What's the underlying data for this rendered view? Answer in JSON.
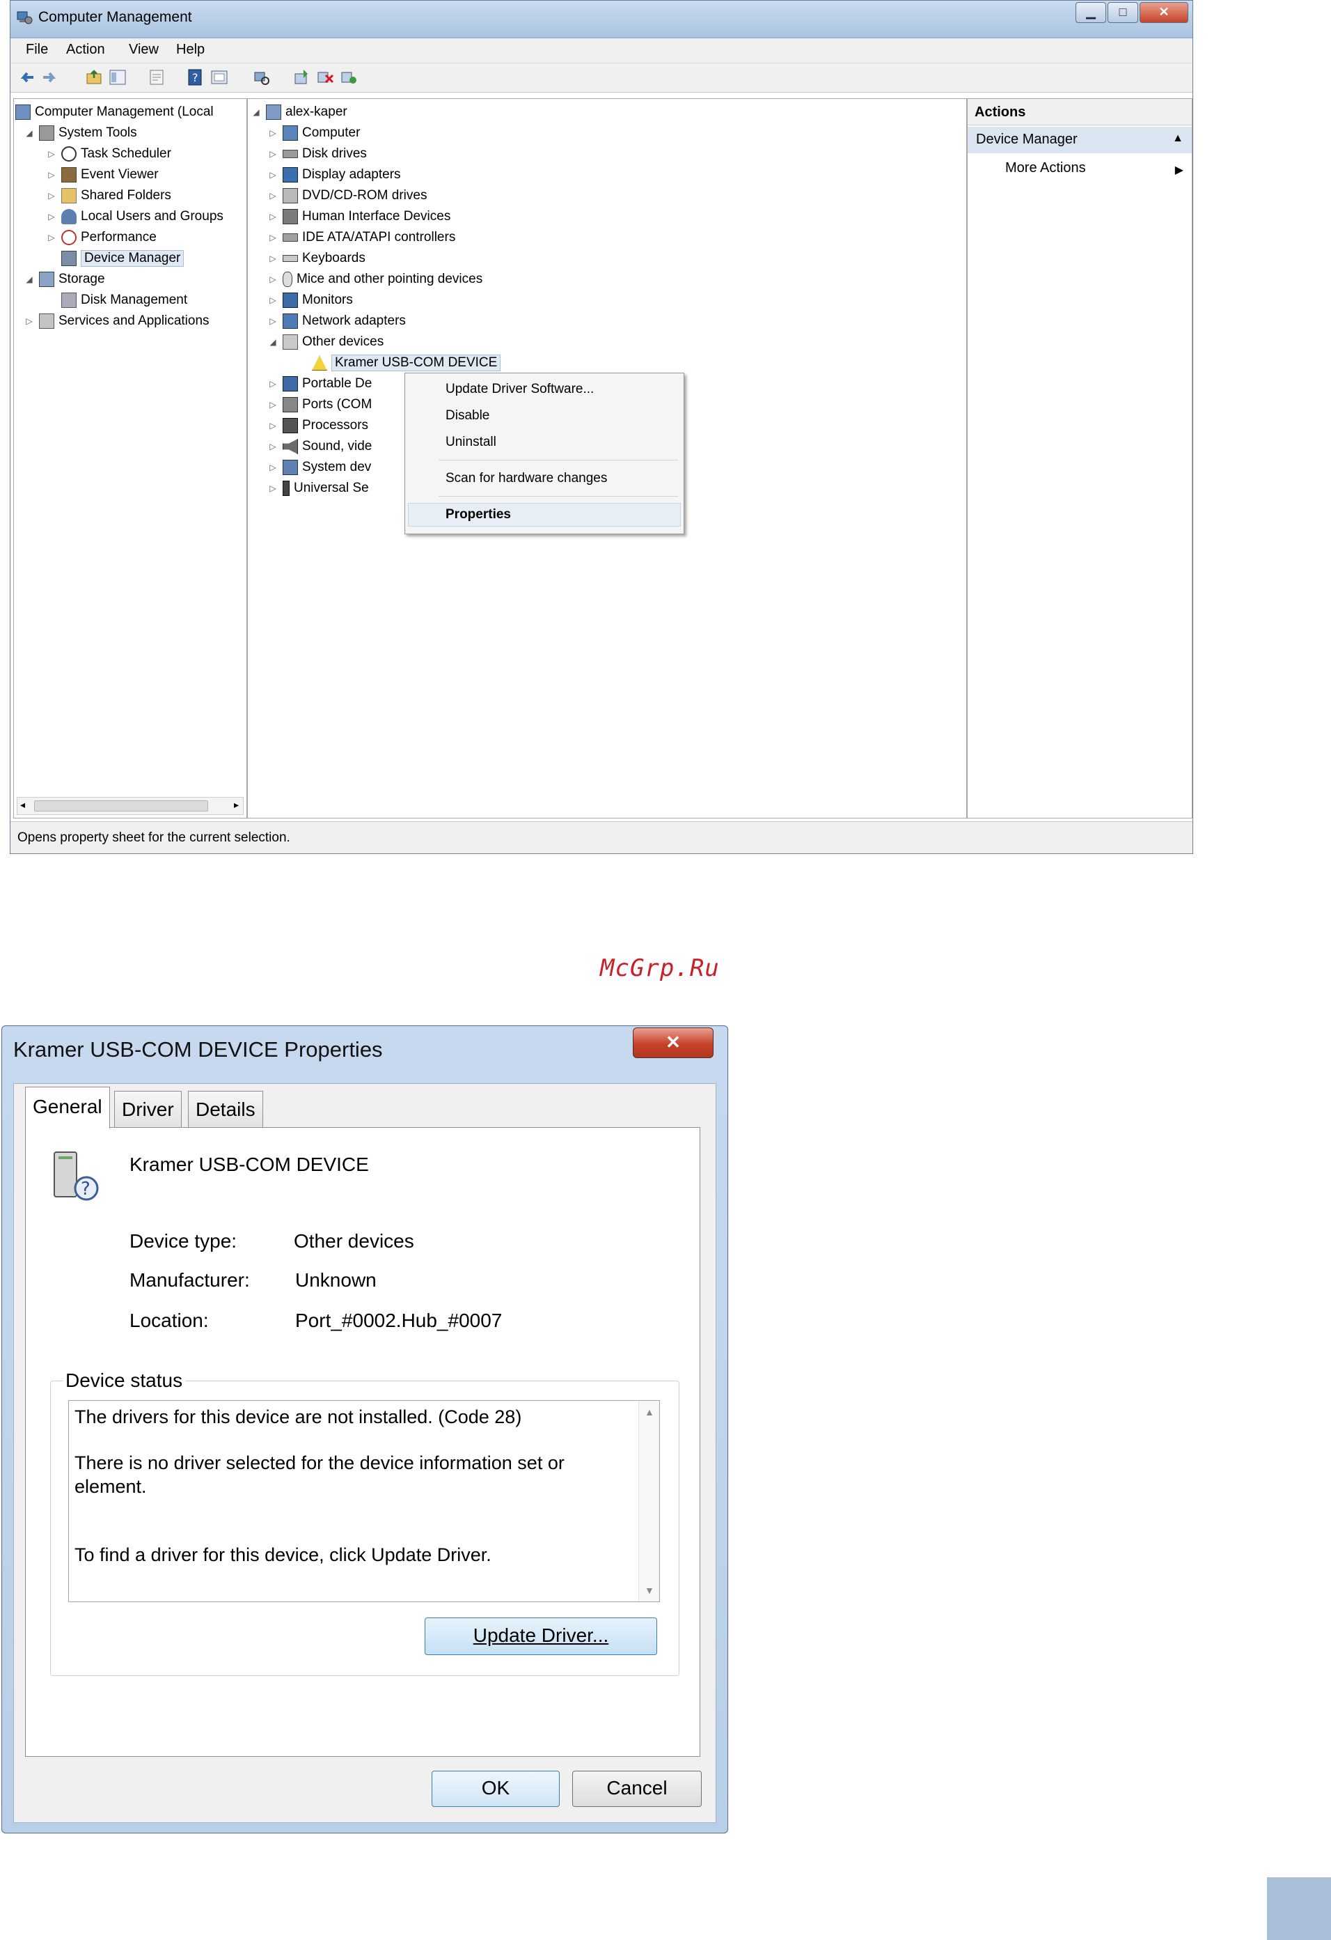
{
  "cm": {
    "title": "Computer Management",
    "menu": [
      "File",
      "Action",
      "View",
      "Help"
    ],
    "left_tree": [
      {
        "label": "Computer Management (Local",
        "indent": 0
      },
      {
        "label": "System Tools",
        "indent": 1
      },
      {
        "label": "Task Scheduler",
        "indent": 2
      },
      {
        "label": "Event Viewer",
        "indent": 2
      },
      {
        "label": "Shared Folders",
        "indent": 2
      },
      {
        "label": "Local Users and Groups",
        "indent": 2
      },
      {
        "label": "Performance",
        "indent": 2
      },
      {
        "label": "Device Manager",
        "indent": 2
      },
      {
        "label": "Storage",
        "indent": 1
      },
      {
        "label": "Disk Management",
        "indent": 2
      },
      {
        "label": "Services and Applications",
        "indent": 1
      }
    ],
    "device_tree": [
      "alex-kaper",
      "Computer",
      "Disk drives",
      "Display adapters",
      "DVD/CD-ROM drives",
      "Human Interface Devices",
      "IDE ATA/ATAPI controllers",
      "Keyboards",
      "Mice and other pointing devices",
      "Monitors",
      "Network adapters",
      "Other devices",
      "Kramer USB-COM DEVICE",
      "Portable De",
      "Ports (COM",
      "Processors",
      "Sound, vide",
      "System dev",
      "Universal Se"
    ],
    "context_menu": [
      "Update Driver Software...",
      "Disable",
      "Uninstall",
      "Scan for hardware changes",
      "Properties"
    ],
    "actions": {
      "header": "Actions",
      "section": "Device Manager",
      "more": "More Actions"
    },
    "status": "Opens property sheet for the current selection."
  },
  "watermark": "McGrp.Ru",
  "dialog": {
    "title": "Kramer USB-COM DEVICE Properties",
    "close": "✕",
    "tabs": [
      "General",
      "Driver",
      "Details"
    ],
    "device_name": "Kramer USB-COM DEVICE",
    "fields": [
      {
        "label": "Device type:",
        "value": "Other devices"
      },
      {
        "label": "Manufacturer:",
        "value": "Unknown"
      },
      {
        "label": "Location:",
        "value": "Port_#0002.Hub_#0007"
      }
    ],
    "status_group": "Device status",
    "status_lines": [
      "The drivers for this device are not installed. (Code 28)",
      "There is no driver selected for the device information set or",
      "element.",
      "To find a driver for this device, click Update Driver."
    ],
    "update_button": "Update Driver...",
    "ok": "OK",
    "cancel": "Cancel"
  },
  "colors": {
    "accent": "#3c7fb1",
    "close_red": "#c5432a",
    "watermark": "#c8202a"
  }
}
